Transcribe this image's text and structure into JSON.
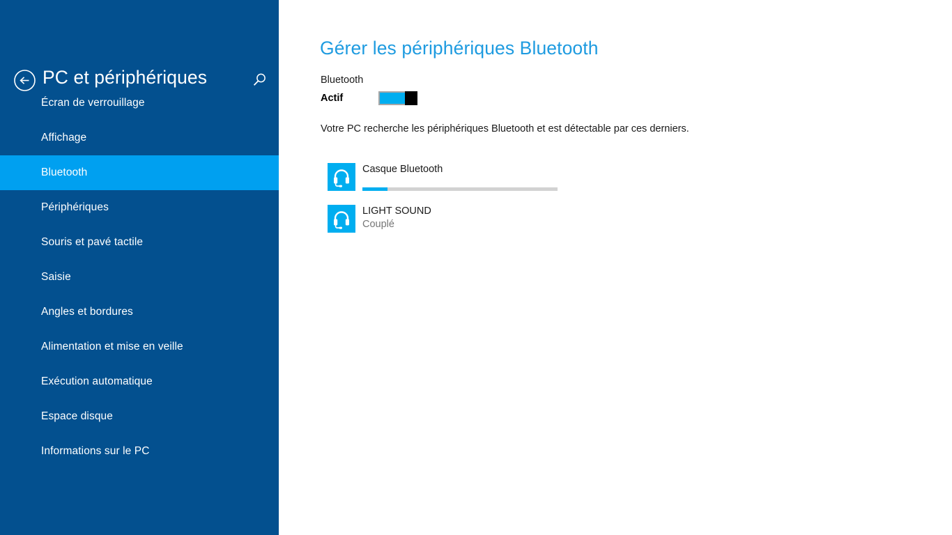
{
  "sidebar": {
    "back_icon": "back-arrow-circle-icon",
    "title": "PC et périphériques",
    "search_icon": "search-icon",
    "items": [
      {
        "label": "Écran de verrouillage",
        "selected": false
      },
      {
        "label": "Affichage",
        "selected": false
      },
      {
        "label": "Bluetooth",
        "selected": true
      },
      {
        "label": "Périphériques",
        "selected": false
      },
      {
        "label": "Souris et pavé tactile",
        "selected": false
      },
      {
        "label": "Saisie",
        "selected": false
      },
      {
        "label": "Angles et bordures",
        "selected": false
      },
      {
        "label": "Alimentation et mise en veille",
        "selected": false
      },
      {
        "label": "Exécution automatique",
        "selected": false
      },
      {
        "label": "Espace disque",
        "selected": false
      },
      {
        "label": "Informations sur le PC",
        "selected": false
      }
    ]
  },
  "main": {
    "title": "Gérer les périphériques Bluetooth",
    "bluetooth_label": "Bluetooth",
    "toggle_state_label": "Actif",
    "toggle_on": true,
    "description": "Votre PC recherche les périphériques Bluetooth et est détectable par ces derniers.",
    "devices": [
      {
        "name": "Casque Bluetooth",
        "status": "",
        "icon": "headset-icon",
        "progress_percent": 13
      },
      {
        "name": "LIGHT SOUND",
        "status": "Couplé",
        "icon": "headset-icon",
        "progress_percent": null
      }
    ]
  },
  "colors": {
    "sidebar_background": "#03508F",
    "sidebar_selected": "#00A0F0",
    "accent": "#00AEF0",
    "title_blue": "#1E9BE0",
    "content_background": "#FFFFFF",
    "progress_track": "#D2D2D2",
    "status_text": "#767676"
  }
}
